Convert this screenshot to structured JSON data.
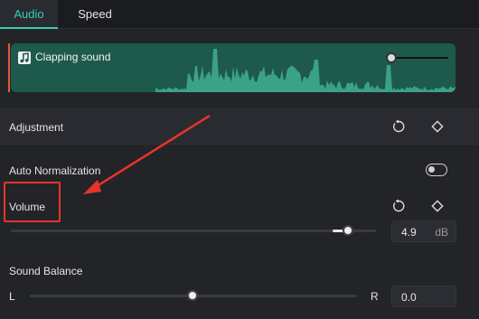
{
  "tabs": [
    {
      "label": "Audio",
      "active": true
    },
    {
      "label": "Speed",
      "active": false
    }
  ],
  "clip": {
    "name": "Clapping sound",
    "icon": "music-note-icon",
    "color": "#1e5a4c",
    "wave_color": "#3aa287"
  },
  "sections": {
    "adjustment": {
      "label": "Adjustment"
    },
    "auto_normalization": {
      "label": "Auto Normalization",
      "enabled": false
    },
    "volume": {
      "label": "Volume",
      "value": "4.9",
      "unit": "dB",
      "slider_level": 0.89
    },
    "sound_balance": {
      "label": "Sound Balance",
      "left_label": "L",
      "right_label": "R",
      "value": "0.0",
      "slider_level": 0.5
    }
  },
  "colors": {
    "accent": "#35d0b8",
    "annotation": "#e8342b"
  }
}
